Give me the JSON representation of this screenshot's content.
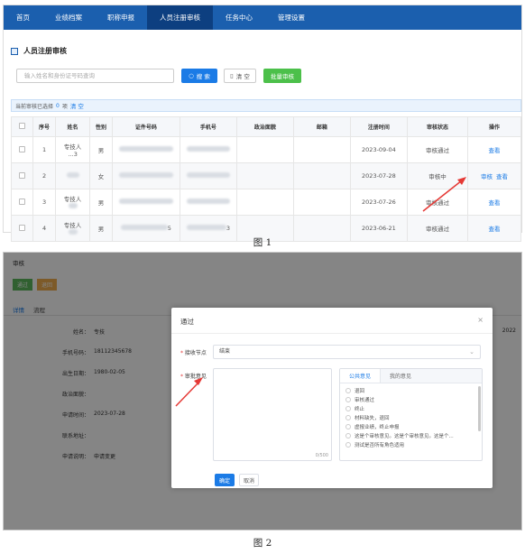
{
  "fig1": {
    "nav": [
      "首页",
      "业绩档案",
      "职称申报",
      "人员注册审核",
      "任务中心",
      "管理设置"
    ],
    "page_title": "人员注册审核",
    "search": {
      "placeholder": "输入姓名和身份证号码查询"
    },
    "buttons": {
      "search": "搜 索",
      "clear": "清 空",
      "batch": "批量审核"
    },
    "selected": {
      "prefix": "当前审核已选择",
      "count": "0",
      "suffix": "项",
      "clear": "清 空"
    },
    "table": {
      "headers": [
        "序号",
        "姓名",
        "性别",
        "证件号码",
        "手机号",
        "政治面貌",
        "邮箱",
        "注册时间",
        "审核状态",
        "操作"
      ],
      "rows": [
        {
          "no": "1",
          "name": "专技人",
          "name2": "…3",
          "gender": "男",
          "date": "2023-09-04",
          "status": "审核通过",
          "ops": [
            "查看"
          ]
        },
        {
          "no": "2",
          "name": "",
          "name2": "",
          "gender": "女",
          "date": "2023-07-28",
          "status": "审核中",
          "ops": [
            "审核",
            "查看"
          ]
        },
        {
          "no": "3",
          "name": "专技人",
          "name2": "",
          "gender": "男",
          "date": "2023-07-26",
          "status": "审核通过",
          "ops": [
            "查看"
          ]
        },
        {
          "no": "4",
          "name": "专技人",
          "name2": "",
          "gender": "男",
          "date": "2023-06-21",
          "status": "审核通过",
          "ops": [
            "查看"
          ]
        }
      ],
      "row4_id_tail": "5",
      "row4_phone_tail": "3"
    },
    "caption": "图 1"
  },
  "fig2": {
    "bg_title": "审核",
    "bg_buttons": [
      "通过",
      "退回"
    ],
    "bg_tabs": [
      "详情",
      "流程"
    ],
    "bg_rows": [
      {
        "label": "姓名：",
        "value": "专技"
      },
      {
        "label": "手机号码：",
        "value": "18112345678"
      },
      {
        "label": "出生日期：",
        "value": "1980-02-05"
      },
      {
        "label": "政治面貌：",
        "value": ""
      },
      {
        "label": "申请时间：",
        "value": "2023-07-28"
      },
      {
        "label": "联系地址：",
        "value": ""
      },
      {
        "label": "申请说明：",
        "value": "申请变更"
      }
    ],
    "bg_right": "2022",
    "dialog": {
      "title": "通过",
      "close": "×",
      "node_label": "接收节点",
      "node_value": "结束",
      "opinion_label": "审批意见",
      "counter": "0/500",
      "tabs": [
        "公共意见",
        "我的意见"
      ],
      "opinions": [
        "退回",
        "审核通过",
        "终止",
        "材料缺失，退回",
        "虚报业绩，终止申报",
        "这是个审核意见。这是个审核意见。这是个...",
        "测试是否所有角色适用"
      ],
      "ok": "确定",
      "cancel": "取消"
    },
    "caption": "图 2"
  }
}
